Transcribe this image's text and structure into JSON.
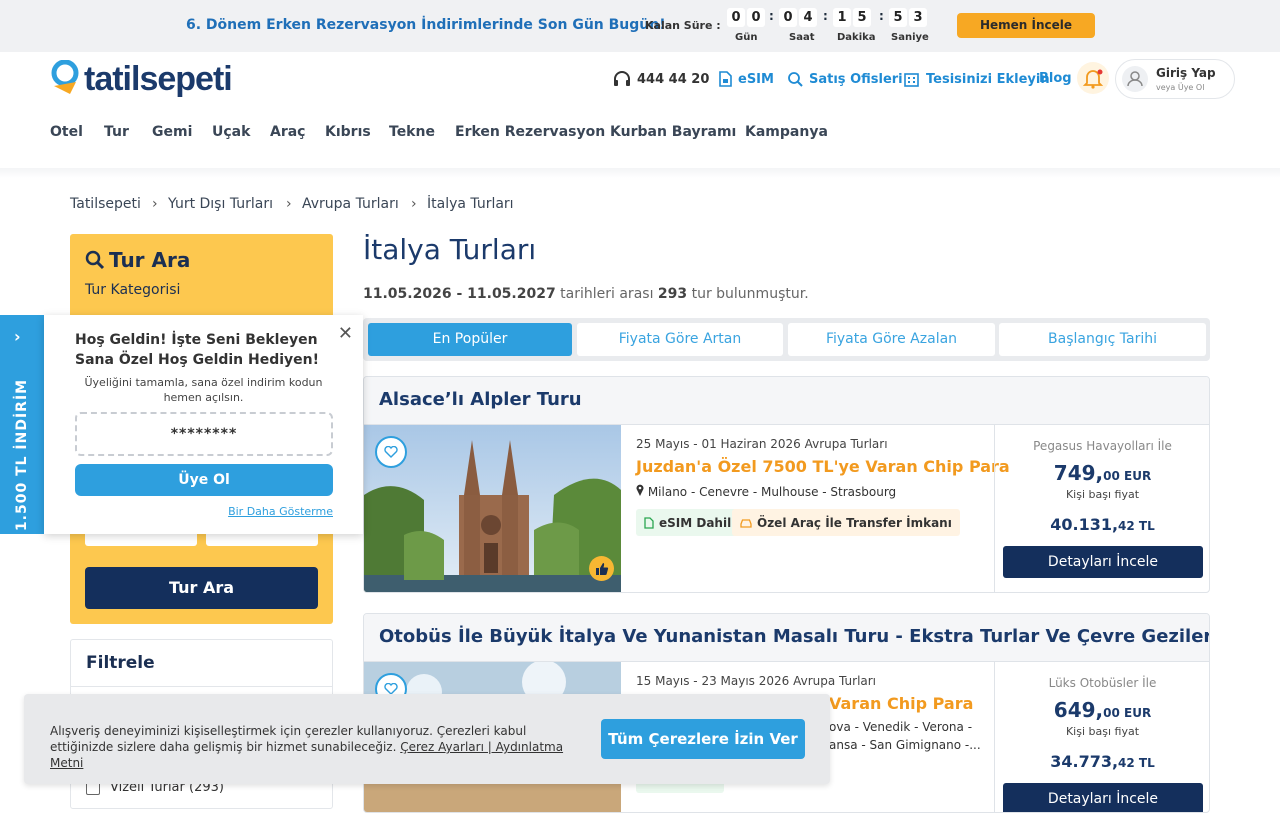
{
  "topbar": {
    "promo": "6. Dönem Erken Rezervasyon İndirimlerinde Son Gün Bugün!",
    "kalan": "Kalan Süre :",
    "countdown": {
      "gun": [
        "0",
        "0"
      ],
      "saat": [
        "0",
        "4"
      ],
      "dakika": [
        "1",
        "5"
      ],
      "saniye": [
        "5",
        "3"
      ],
      "labels": {
        "gun": "Gün",
        "saat": "Saat",
        "dakika": "Dakika",
        "saniye": "Saniye"
      }
    },
    "cta": "Hemen İncele"
  },
  "header": {
    "logo": "tatilsepeti",
    "phone": "444 44 20",
    "esim": "eSIM",
    "satis": "Satış Ofisleri",
    "tesis": "Tesisinizi Ekleyin",
    "blog": "Blog",
    "login_title": "Giriş Yap",
    "login_sub": "veya Üye Ol"
  },
  "nav": [
    "Otel",
    "Tur",
    "Gemi",
    "Uçak",
    "Araç",
    "Kıbrıs",
    "Tekne",
    "Erken Rezervasyon",
    "Kurban Bayramı",
    "Kampanya"
  ],
  "breadcrumb": [
    "Tatilsepeti",
    "Yurt Dışı Turları",
    "Avrupa Turları",
    "İtalya Turları"
  ],
  "search": {
    "title": "Tur Ara",
    "category_label": "Tur Kategorisi",
    "button": "Tur Ara"
  },
  "filter": {
    "title": "Filtrele",
    "vizeli": "Vizeli Turlar (293)"
  },
  "main": {
    "title": "İtalya Turları",
    "date_from": "11.05.2026",
    "date_to": "11.05.2027",
    "mid": " tarihleri arası ",
    "count": "293",
    "tail": " tur bulunmuştur.",
    "sep": " - "
  },
  "sort_tabs": [
    "En Popüler",
    "Fiyata Göre Artan",
    "Fiyata Göre Azalan",
    "Başlangıç Tarihi"
  ],
  "tours": [
    {
      "title": "Alsace’lı Alpler Turu",
      "dates": "25 Mayıs - 01 Haziran 2026 Avrupa Turları",
      "chip": "Juzdan'a Özel 7500 TL'ye Varan Chip Para",
      "route": "Milano - Cenevre - Mulhouse - Strasbourg",
      "tag1": "eSIM Dahil",
      "tag2": "Özel Araç İle Transfer İmkanı",
      "airline": "Pegasus Havayolları İle",
      "eur_int": "749,",
      "eur_dec": "00 EUR",
      "kisi": "Kişi başı fiyat",
      "tl_int": "40.131,",
      "tl_dec": "42 TL",
      "detay": "Detayları İncele"
    },
    {
      "title": "Otobüs İle Büyük İtalya Ve Yunanistan Masalı Turu - Ekstra Turlar Ve Çevre Gezileri Dahil!",
      "dates": "15 Mayıs - 23 Mayıs 2026 Avrupa Turları",
      "chip": "Varan Chip Para",
      "route1": "ova - Venedik - Verona -",
      "route2": "ansa - San Gimignano -...",
      "airline": "Lüks Otobüsler İle",
      "eur_int": "649,",
      "eur_dec": "00 EUR",
      "kisi": "Kişi başı fiyat",
      "tl_int": "34.773,",
      "tl_dec": "42 TL",
      "detay": "Detayları İncele"
    }
  ],
  "side_tab": "1.500 TL İNDİRİM",
  "popup": {
    "title": "Hoş Geldin! İşte Seni Bekleyen Sana Özel Hoş Geldin Hediyen!",
    "sub": "Üyeliğini tamamla, sana özel indirim kodun hemen açılsın.",
    "code": "********",
    "button": "Üye Ol",
    "link": "Bir Daha Gösterme"
  },
  "cookie": {
    "text": "Alışveriş deneyiminizi kişiselleştirmek için çerezler kullanıyoruz. Çerezleri kabul ettiğinizde sizlere daha gelişmiş bir hizmet sunabileceğiz. ",
    "link": "Çerez Ayarları | Aydınlatma Metni",
    "button": "Tüm Çerezlere İzin Ver"
  },
  "colors": {
    "brand_blue": "#1b3a6b",
    "accent_blue": "#2e9fde",
    "yellow": "#fdc84f",
    "orange": "#f7a823",
    "navy": "#142f5c"
  }
}
